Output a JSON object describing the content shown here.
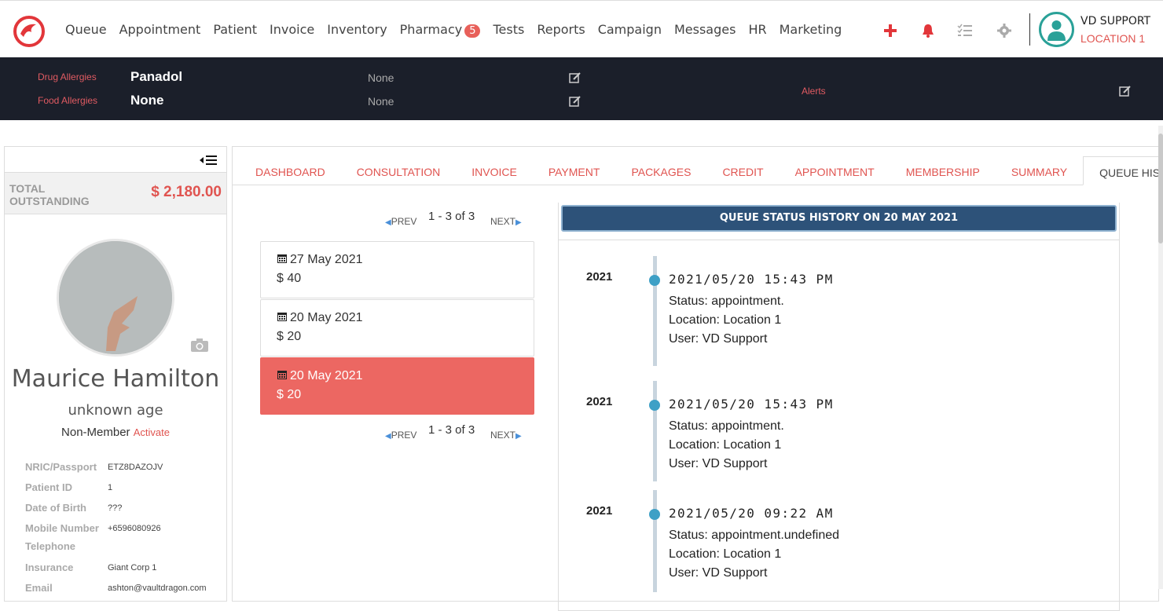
{
  "nav": {
    "items": [
      "Queue",
      "Appointment",
      "Patient",
      "Invoice",
      "Inventory",
      "Pharmacy",
      "Tests",
      "Reports",
      "Campaign",
      "Messages",
      "HR",
      "Marketing"
    ],
    "pharmacy_badge": "5",
    "icons": [
      "plus-icon",
      "bell-icon",
      "checklist-icon",
      "gear-icon"
    ]
  },
  "user": {
    "name": "VD SUPPORT",
    "location": "LOCATION 1"
  },
  "allergies": {
    "drug_label": "Drug Allergies",
    "drug_value": "Panadol",
    "drug_note": "None",
    "food_label": "Food Allergies",
    "food_value": "None",
    "food_note": "None",
    "alerts_label": "Alerts"
  },
  "sidebar": {
    "outstanding_label": "TOTAL OUTSTANDING",
    "outstanding_value": "$ 2,180.00",
    "patient_name": "Maurice Hamilton",
    "age": "unknown age",
    "membership": "Non-Member",
    "activate": "Activate",
    "info": [
      {
        "key": "NRIC/Passport",
        "value": "ETZ8DAZOJV"
      },
      {
        "key": "Patient ID",
        "value": "1"
      },
      {
        "key": "Date of Birth",
        "value": "???"
      },
      {
        "key": "Mobile Number",
        "value": "+6596080926"
      },
      {
        "key": "Telephone",
        "value": ""
      },
      {
        "key": "Insurance",
        "value": "Giant Corp 1"
      },
      {
        "key": "Email",
        "value": "ashton@vaultdragon.com"
      }
    ]
  },
  "tabs": [
    "DASHBOARD",
    "CONSULTATION",
    "INVOICE",
    "PAYMENT",
    "PACKAGES",
    "CREDIT",
    "APPOINTMENT",
    "MEMBERSHIP",
    "SUMMARY",
    "QUEUE HISTORY"
  ],
  "pager": {
    "prev": "PREV",
    "next": "NEXT",
    "range": "1 - 3 of 3"
  },
  "visits": [
    {
      "date": "27 May 2021",
      "amount": "$ 40"
    },
    {
      "date": "20 May 2021",
      "amount": "$ 20"
    },
    {
      "date": "20 May 2021",
      "amount": "$ 20"
    }
  ],
  "history": {
    "title": "QUEUE STATUS HISTORY ON 20 MAY 2021",
    "entries": [
      {
        "year": "2021",
        "time": "2021/05/20 15:43 PM",
        "status": "Status:  appointment.",
        "location": "Location: Location 1",
        "user": "User: VD Support"
      },
      {
        "year": "2021",
        "time": "2021/05/20 15:43 PM",
        "status": "Status:  appointment.",
        "location": "Location: Location 1",
        "user": "User: VD Support"
      },
      {
        "year": "2021",
        "time": "2021/05/20 09:22 AM",
        "status": "Status:  appointment.undefined",
        "location": "Location: Location 1",
        "user": "User: VD Support"
      }
    ]
  },
  "colors": {
    "accent": "#e05450",
    "dark_bar": "#1b1f2a",
    "header_blue": "#2d5279",
    "timeline_dot": "#3ea0c6"
  }
}
